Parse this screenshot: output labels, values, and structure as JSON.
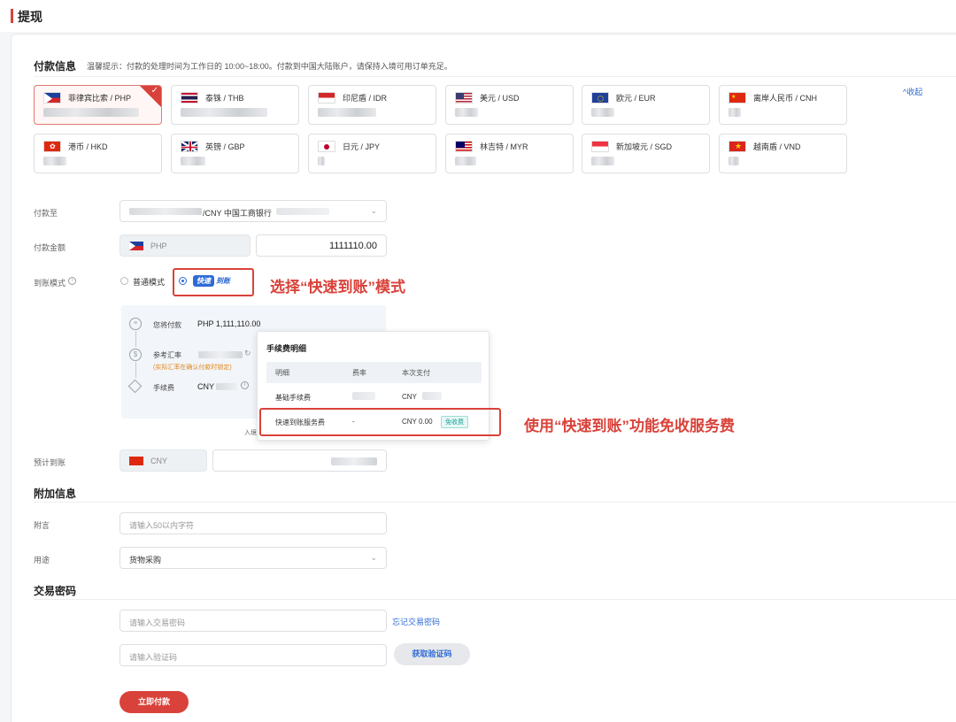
{
  "page": {
    "title": "提现"
  },
  "payment_info": {
    "title": "付款信息",
    "hint": "温馨提示：付款的处理时间为工作日的 10:00~18:00。付款到中国大陆账户，请保持入境可用订单充足。",
    "collapse": "^收起",
    "currencies": [
      {
        "name": "菲律宾比索 / PHP",
        "selected": true
      },
      {
        "name": "泰铢 / THB",
        "selected": false
      },
      {
        "name": "印尼盾 / IDR",
        "selected": false
      },
      {
        "name": "美元 / USD",
        "selected": false
      },
      {
        "name": "欧元 / EUR",
        "selected": false
      },
      {
        "name": "离岸人民币 / CNH",
        "selected": false
      },
      {
        "name": "港币 / HKD",
        "selected": false
      },
      {
        "name": "英镑 / GBP",
        "selected": false
      },
      {
        "name": "日元 / JPY",
        "selected": false
      },
      {
        "name": "林吉特 / MYR",
        "selected": false
      },
      {
        "name": "新加坡元 / SGD",
        "selected": false
      },
      {
        "name": "越南盾 / VND",
        "selected": false
      }
    ]
  },
  "pay_to": {
    "label": "付款至",
    "value": "/CNY 中国工商银行"
  },
  "amount": {
    "label": "付款金额",
    "currency": "PHP",
    "value": "1111110.00"
  },
  "mode": {
    "label": "到账模式",
    "normal": "普通模式",
    "fast_tag": "快速",
    "fast_text": "到账",
    "annotation": "选择“快速到账”模式"
  },
  "details": {
    "pay_label": "您将付款",
    "pay_value": "PHP 1,111,110.00",
    "rate_label": "参考汇率",
    "rate_note": "(实际汇率在确认付款时锁定)",
    "fee_label": "手续费",
    "fee_value": "CNY",
    "footer_fragment": "入境"
  },
  "fee_popup": {
    "title": "手续费明细",
    "headers": [
      "明细",
      "费率",
      "本次支付"
    ],
    "rows": [
      {
        "item": "基础手续费",
        "rate": "",
        "amount": "CNY"
      },
      {
        "item": "快速到账服务费",
        "rate": "-",
        "amount": "CNY 0.00",
        "badge": "免收费"
      }
    ],
    "annotation": "使用“快速到账”功能免收服务费"
  },
  "expected": {
    "label": "预计到账",
    "currency": "CNY"
  },
  "extra_info": {
    "title": "附加信息",
    "note_label": "附言",
    "note_placeholder": "请输入50以内字符",
    "purpose_label": "用途",
    "purpose_value": "货物采购"
  },
  "password": {
    "title": "交易密码",
    "password_placeholder": "请输入交易密码",
    "forgot": "忘记交易密码",
    "code_placeholder": "请输入验证码",
    "get_code": "获取验证码"
  },
  "submit": "立即付款",
  "colors": {
    "accent": "#d9423a",
    "link": "#2f6bd6",
    "badge": "#1aa39a"
  }
}
